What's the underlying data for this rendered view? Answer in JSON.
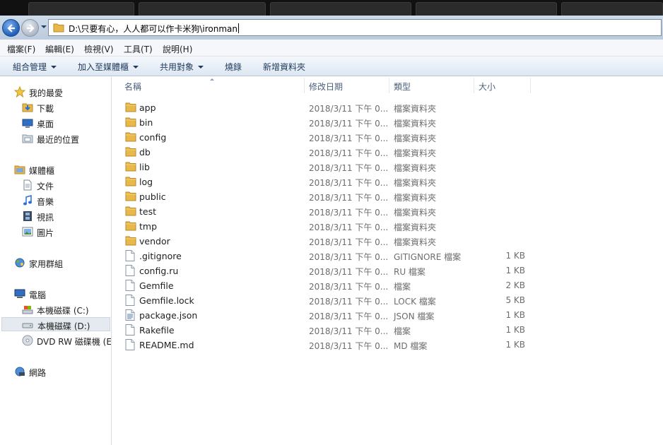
{
  "address": {
    "path": "D:\\只要有心，人人都可以作卡米狗\\ironman"
  },
  "menu": [
    "檔案(F)",
    "編輯(E)",
    "檢視(V)",
    "工具(T)",
    "說明(H)"
  ],
  "commands": [
    {
      "label": "組合管理",
      "dropdown": true
    },
    {
      "label": "加入至媒體櫃",
      "dropdown": true
    },
    {
      "label": "共用對象",
      "dropdown": true
    },
    {
      "label": "燒錄",
      "dropdown": false
    },
    {
      "label": "新增資料夾",
      "dropdown": false
    }
  ],
  "nav": {
    "favorites": {
      "label": "我的最愛",
      "items": [
        "下載",
        "桌面",
        "最近的位置"
      ]
    },
    "libraries": {
      "label": "媒體櫃",
      "items": [
        "文件",
        "音樂",
        "視訊",
        "圖片"
      ]
    },
    "homegroup": {
      "label": "家用群組"
    },
    "computer": {
      "label": "電腦",
      "items": [
        "本機磁碟 (C:)",
        "本機磁碟 (D:)",
        "DVD RW 磁碟機 (E:"
      ]
    },
    "network": {
      "label": "網路"
    }
  },
  "columns": {
    "name": "名稱",
    "date": "修改日期",
    "type": "類型",
    "size": "大小"
  },
  "files": [
    {
      "name": "app",
      "date": "2018/3/11 下午 0...",
      "type": "檔案資料夾",
      "size": "",
      "kind": "folder"
    },
    {
      "name": "bin",
      "date": "2018/3/11 下午 0...",
      "type": "檔案資料夾",
      "size": "",
      "kind": "folder"
    },
    {
      "name": "config",
      "date": "2018/3/11 下午 0...",
      "type": "檔案資料夾",
      "size": "",
      "kind": "folder"
    },
    {
      "name": "db",
      "date": "2018/3/11 下午 0...",
      "type": "檔案資料夾",
      "size": "",
      "kind": "folder"
    },
    {
      "name": "lib",
      "date": "2018/3/11 下午 0...",
      "type": "檔案資料夾",
      "size": "",
      "kind": "folder"
    },
    {
      "name": "log",
      "date": "2018/3/11 下午 0...",
      "type": "檔案資料夾",
      "size": "",
      "kind": "folder"
    },
    {
      "name": "public",
      "date": "2018/3/11 下午 0...",
      "type": "檔案資料夾",
      "size": "",
      "kind": "folder"
    },
    {
      "name": "test",
      "date": "2018/3/11 下午 0...",
      "type": "檔案資料夾",
      "size": "",
      "kind": "folder"
    },
    {
      "name": "tmp",
      "date": "2018/3/11 下午 0...",
      "type": "檔案資料夾",
      "size": "",
      "kind": "folder"
    },
    {
      "name": "vendor",
      "date": "2018/3/11 下午 0...",
      "type": "檔案資料夾",
      "size": "",
      "kind": "folder"
    },
    {
      "name": ".gitignore",
      "date": "2018/3/11 下午 0...",
      "type": "GITIGNORE 檔案",
      "size": "1 KB",
      "kind": "file"
    },
    {
      "name": "config.ru",
      "date": "2018/3/11 下午 0...",
      "type": "RU 檔案",
      "size": "1 KB",
      "kind": "file"
    },
    {
      "name": "Gemfile",
      "date": "2018/3/11 下午 0...",
      "type": "檔案",
      "size": "2 KB",
      "kind": "file"
    },
    {
      "name": "Gemfile.lock",
      "date": "2018/3/11 下午 0...",
      "type": "LOCK 檔案",
      "size": "5 KB",
      "kind": "file"
    },
    {
      "name": "package.json",
      "date": "2018/3/11 下午 0...",
      "type": "JSON 檔案",
      "size": "1 KB",
      "kind": "textfile"
    },
    {
      "name": "Rakefile",
      "date": "2018/3/11 下午 0...",
      "type": "檔案",
      "size": "1 KB",
      "kind": "file"
    },
    {
      "name": "README.md",
      "date": "2018/3/11 下午 0...",
      "type": "MD 檔案",
      "size": "1 KB",
      "kind": "file"
    }
  ],
  "colors": {
    "accent": "#1f5fb8",
    "folder": "#e8b84a",
    "selected": "#e5eaf0"
  }
}
